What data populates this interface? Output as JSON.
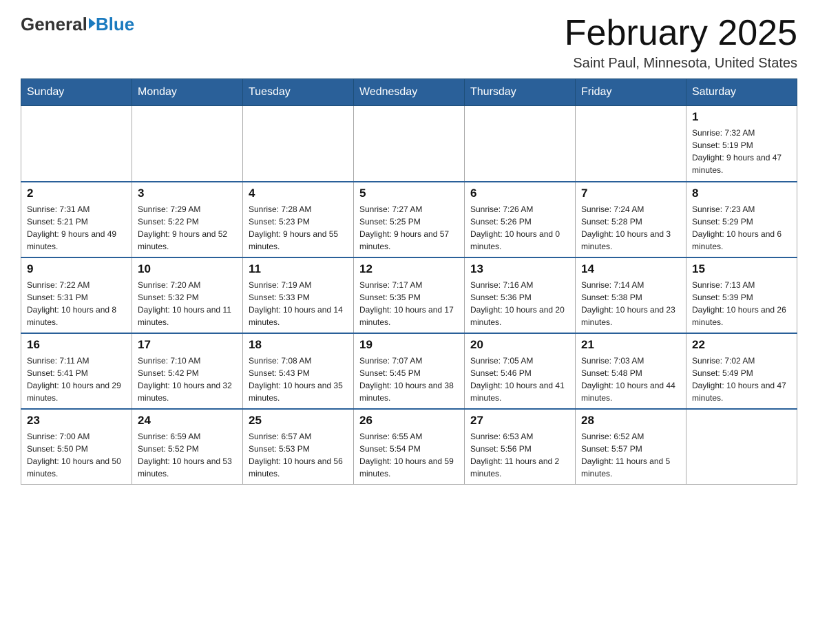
{
  "header": {
    "logo_general": "General",
    "logo_blue": "Blue",
    "title": "February 2025",
    "subtitle": "Saint Paul, Minnesota, United States"
  },
  "days_of_week": [
    "Sunday",
    "Monday",
    "Tuesday",
    "Wednesday",
    "Thursday",
    "Friday",
    "Saturday"
  ],
  "weeks": [
    [
      {
        "day": "",
        "sunrise": "",
        "sunset": "",
        "daylight": ""
      },
      {
        "day": "",
        "sunrise": "",
        "sunset": "",
        "daylight": ""
      },
      {
        "day": "",
        "sunrise": "",
        "sunset": "",
        "daylight": ""
      },
      {
        "day": "",
        "sunrise": "",
        "sunset": "",
        "daylight": ""
      },
      {
        "day": "",
        "sunrise": "",
        "sunset": "",
        "daylight": ""
      },
      {
        "day": "",
        "sunrise": "",
        "sunset": "",
        "daylight": ""
      },
      {
        "day": "1",
        "sunrise": "Sunrise: 7:32 AM",
        "sunset": "Sunset: 5:19 PM",
        "daylight": "Daylight: 9 hours and 47 minutes."
      }
    ],
    [
      {
        "day": "2",
        "sunrise": "Sunrise: 7:31 AM",
        "sunset": "Sunset: 5:21 PM",
        "daylight": "Daylight: 9 hours and 49 minutes."
      },
      {
        "day": "3",
        "sunrise": "Sunrise: 7:29 AM",
        "sunset": "Sunset: 5:22 PM",
        "daylight": "Daylight: 9 hours and 52 minutes."
      },
      {
        "day": "4",
        "sunrise": "Sunrise: 7:28 AM",
        "sunset": "Sunset: 5:23 PM",
        "daylight": "Daylight: 9 hours and 55 minutes."
      },
      {
        "day": "5",
        "sunrise": "Sunrise: 7:27 AM",
        "sunset": "Sunset: 5:25 PM",
        "daylight": "Daylight: 9 hours and 57 minutes."
      },
      {
        "day": "6",
        "sunrise": "Sunrise: 7:26 AM",
        "sunset": "Sunset: 5:26 PM",
        "daylight": "Daylight: 10 hours and 0 minutes."
      },
      {
        "day": "7",
        "sunrise": "Sunrise: 7:24 AM",
        "sunset": "Sunset: 5:28 PM",
        "daylight": "Daylight: 10 hours and 3 minutes."
      },
      {
        "day": "8",
        "sunrise": "Sunrise: 7:23 AM",
        "sunset": "Sunset: 5:29 PM",
        "daylight": "Daylight: 10 hours and 6 minutes."
      }
    ],
    [
      {
        "day": "9",
        "sunrise": "Sunrise: 7:22 AM",
        "sunset": "Sunset: 5:31 PM",
        "daylight": "Daylight: 10 hours and 8 minutes."
      },
      {
        "day": "10",
        "sunrise": "Sunrise: 7:20 AM",
        "sunset": "Sunset: 5:32 PM",
        "daylight": "Daylight: 10 hours and 11 minutes."
      },
      {
        "day": "11",
        "sunrise": "Sunrise: 7:19 AM",
        "sunset": "Sunset: 5:33 PM",
        "daylight": "Daylight: 10 hours and 14 minutes."
      },
      {
        "day": "12",
        "sunrise": "Sunrise: 7:17 AM",
        "sunset": "Sunset: 5:35 PM",
        "daylight": "Daylight: 10 hours and 17 minutes."
      },
      {
        "day": "13",
        "sunrise": "Sunrise: 7:16 AM",
        "sunset": "Sunset: 5:36 PM",
        "daylight": "Daylight: 10 hours and 20 minutes."
      },
      {
        "day": "14",
        "sunrise": "Sunrise: 7:14 AM",
        "sunset": "Sunset: 5:38 PM",
        "daylight": "Daylight: 10 hours and 23 minutes."
      },
      {
        "day": "15",
        "sunrise": "Sunrise: 7:13 AM",
        "sunset": "Sunset: 5:39 PM",
        "daylight": "Daylight: 10 hours and 26 minutes."
      }
    ],
    [
      {
        "day": "16",
        "sunrise": "Sunrise: 7:11 AM",
        "sunset": "Sunset: 5:41 PM",
        "daylight": "Daylight: 10 hours and 29 minutes."
      },
      {
        "day": "17",
        "sunrise": "Sunrise: 7:10 AM",
        "sunset": "Sunset: 5:42 PM",
        "daylight": "Daylight: 10 hours and 32 minutes."
      },
      {
        "day": "18",
        "sunrise": "Sunrise: 7:08 AM",
        "sunset": "Sunset: 5:43 PM",
        "daylight": "Daylight: 10 hours and 35 minutes."
      },
      {
        "day": "19",
        "sunrise": "Sunrise: 7:07 AM",
        "sunset": "Sunset: 5:45 PM",
        "daylight": "Daylight: 10 hours and 38 minutes."
      },
      {
        "day": "20",
        "sunrise": "Sunrise: 7:05 AM",
        "sunset": "Sunset: 5:46 PM",
        "daylight": "Daylight: 10 hours and 41 minutes."
      },
      {
        "day": "21",
        "sunrise": "Sunrise: 7:03 AM",
        "sunset": "Sunset: 5:48 PM",
        "daylight": "Daylight: 10 hours and 44 minutes."
      },
      {
        "day": "22",
        "sunrise": "Sunrise: 7:02 AM",
        "sunset": "Sunset: 5:49 PM",
        "daylight": "Daylight: 10 hours and 47 minutes."
      }
    ],
    [
      {
        "day": "23",
        "sunrise": "Sunrise: 7:00 AM",
        "sunset": "Sunset: 5:50 PM",
        "daylight": "Daylight: 10 hours and 50 minutes."
      },
      {
        "day": "24",
        "sunrise": "Sunrise: 6:59 AM",
        "sunset": "Sunset: 5:52 PM",
        "daylight": "Daylight: 10 hours and 53 minutes."
      },
      {
        "day": "25",
        "sunrise": "Sunrise: 6:57 AM",
        "sunset": "Sunset: 5:53 PM",
        "daylight": "Daylight: 10 hours and 56 minutes."
      },
      {
        "day": "26",
        "sunrise": "Sunrise: 6:55 AM",
        "sunset": "Sunset: 5:54 PM",
        "daylight": "Daylight: 10 hours and 59 minutes."
      },
      {
        "day": "27",
        "sunrise": "Sunrise: 6:53 AM",
        "sunset": "Sunset: 5:56 PM",
        "daylight": "Daylight: 11 hours and 2 minutes."
      },
      {
        "day": "28",
        "sunrise": "Sunrise: 6:52 AM",
        "sunset": "Sunset: 5:57 PM",
        "daylight": "Daylight: 11 hours and 5 minutes."
      },
      {
        "day": "",
        "sunrise": "",
        "sunset": "",
        "daylight": ""
      }
    ]
  ]
}
